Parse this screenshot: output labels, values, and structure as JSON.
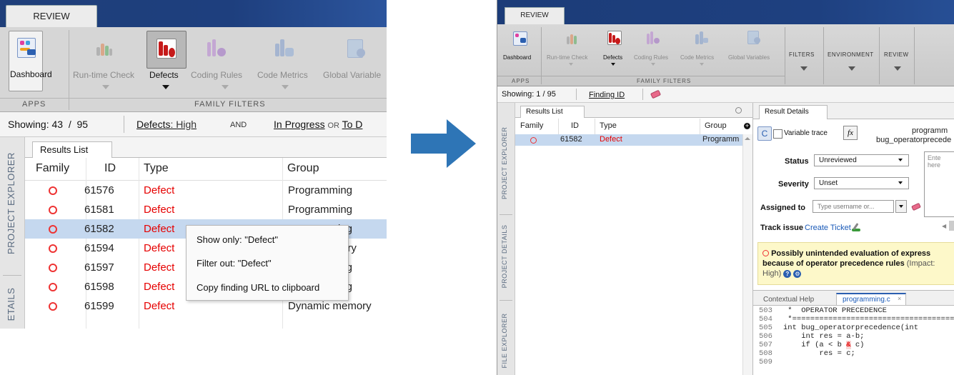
{
  "left": {
    "tab_review": "REVIEW",
    "toolstrip": {
      "dashboard": "Dashboard",
      "runtime_check": "Run-time Check",
      "defects": "Defects",
      "coding_rules": "Coding Rules",
      "code_metrics": "Code Metrics",
      "global_variables": "Global Variable",
      "section_apps": "APPS",
      "section_family_filters": "FAMILY FILTERS"
    },
    "filterbar": {
      "showing": "Showing: 43  /  95",
      "defects_label": "Defects",
      "defects_value": ": High",
      "and": "AND",
      "in_progress": "In Progress",
      "or": "OR",
      "to_d": "To D"
    },
    "sidebar": {
      "project_explorer": "PROJECT EXPLORER",
      "details": "ETAILS"
    },
    "results_tab": "Results List",
    "columns": {
      "family": "Family",
      "id": "ID",
      "type": "Type",
      "group": "Group"
    },
    "rows": [
      {
        "id": "61576",
        "type": "Defect",
        "group": "Programming"
      },
      {
        "id": "61581",
        "type": "Defect",
        "group": "Programming"
      },
      {
        "id": "61582",
        "type": "Defect",
        "group": "Programming"
      },
      {
        "id": "61594",
        "type": "Defect",
        "group": "Static memory"
      },
      {
        "id": "61597",
        "type": "Defect",
        "group": "Programming"
      },
      {
        "id": "61598",
        "type": "Defect",
        "group": "Programming"
      },
      {
        "id": "61599",
        "type": "Defect",
        "group": "Dynamic memory"
      }
    ],
    "context_menu": {
      "show_only": "Show only: \"Defect\"",
      "filter_out": "Filter out: \"Defect\"",
      "copy_url": "Copy finding URL to clipboard"
    }
  },
  "right": {
    "tab_review": "REVIEW",
    "toolstrip": {
      "dashboard": "Dashboard",
      "runtime_check": "Run-time Check",
      "defects": "Defects",
      "coding_rules": "Coding Rules",
      "code_metrics": "Code Metrics",
      "global_variables": "Global Variables",
      "filters": "FILTERS",
      "environment": "ENVIRONMENT",
      "review": "REVIEW",
      "section_apps": "APPS",
      "section_family_filters": "FAMILY FILTERS"
    },
    "filterbar": {
      "showing": "Showing: 1 / 95",
      "finding_id": "Finding ID"
    },
    "sidebar": {
      "project_explorer": "PROJECT EXPLORER",
      "project_details": "PROJECT DETAILS",
      "file_explorer": "FILE EXPLORER"
    },
    "results_tab": "Results List",
    "columns": {
      "family": "Family",
      "id": "ID",
      "type": "Type",
      "group": "Group"
    },
    "row": {
      "id": "61582",
      "type": "Defect",
      "group": "Programm"
    },
    "details": {
      "tab": "Result Details",
      "variable_trace": "Variable trace",
      "fx": "fx",
      "title_line1": "programm",
      "title_line2": "bug_operatorprecede",
      "status_label": "Status",
      "status_value": "Unreviewed",
      "severity_label": "Severity",
      "severity_value": "Unset",
      "assigned_label": "Assigned to",
      "assigned_placeholder": "Type username or...",
      "comment_placeholder": "Ente here",
      "track_label": "Track issue",
      "create_ticket": "Create Ticket",
      "message_line1": "Possibly unintended evaluation of express",
      "message_line2": "because of operator precedence rules",
      "message_impact": "(Impact:",
      "message_line3": "High)"
    },
    "code_tabs": {
      "contextual_help": "Contextual Help",
      "file": "programming.c"
    },
    "code": {
      "line_numbers": [
        "503",
        "504",
        "505",
        "506",
        "507",
        "508",
        "509"
      ],
      "lines": [
        " *  OPERATOR PRECEDENCE",
        " *=====================================",
        "int bug_operatorprecedence(int",
        "    int res = a-b;",
        "    if (a < b ",
        "        res = c;",
        ""
      ],
      "line507_op": "&",
      "line507_tail": " c)"
    }
  },
  "colors": {
    "ribbon_blue": "#1b3f7e",
    "toolstrip_grey": "#d5d5d5",
    "selected_row": "#c5d8ef",
    "defect_red": "#e60000",
    "arrow_blue": "#2e75b6",
    "message_yellow": "#fdf8c9"
  }
}
